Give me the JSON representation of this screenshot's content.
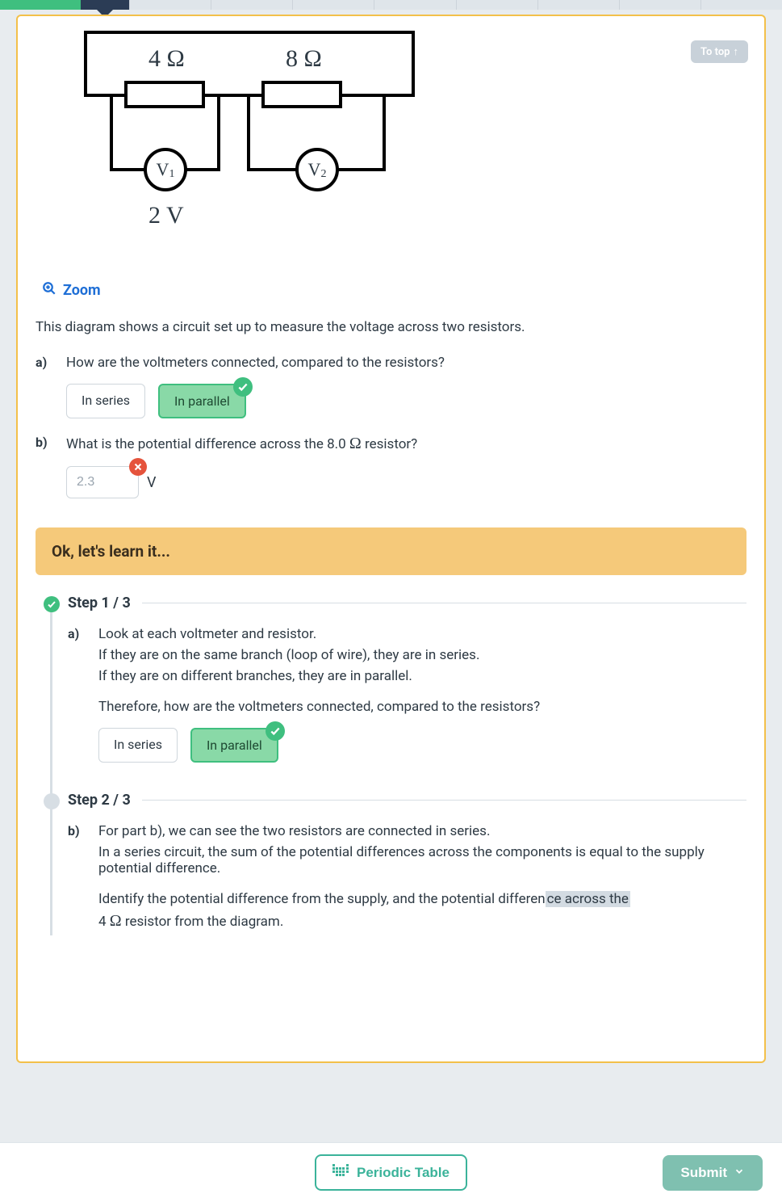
{
  "topbar": {
    "to_top": "To top"
  },
  "diagram": {
    "r1_label": "4 Ω",
    "r2_label": "8 Ω",
    "v1_label": "V",
    "v1_sub": "1",
    "v2_label": "V",
    "v2_sub": "2",
    "reading": "2 V"
  },
  "zoom_label": "Zoom",
  "stem": "This diagram shows a circuit set up to measure the voltage across two resistors.",
  "q_a": {
    "label": "a)",
    "text": "How are the voltmeters connected, compared to the resistors?",
    "choices": {
      "series": "In series",
      "parallel": "In parallel"
    }
  },
  "q_b": {
    "label": "b)",
    "text_before": "What is the potential difference across the 8.0 ",
    "ohm": "Ω",
    "text_after": " resistor?",
    "value": "2.3",
    "unit": "V"
  },
  "banner": "Ok, let's learn it...",
  "step1": {
    "title": "Step 1 / 3",
    "label": "a)",
    "l1": "Look at each voltmeter and resistor.",
    "l2": "If they are on the same branch (loop of wire), they are in series.",
    "l3": "If they are on different branches, they are in parallel.",
    "l4": "Therefore, how are the voltmeters connected, compared to the resistors?",
    "choices": {
      "series": "In series",
      "parallel": "In parallel"
    }
  },
  "step2": {
    "title": "Step 2 / 3",
    "label": "b)",
    "l1": "For part b), we can see the two resistors are connected in series.",
    "l2": "In a series circuit, the sum of the potential differences across the components is equal to the supply potential difference.",
    "l3a": "Identify the potential difference from the supply, and the potential differen",
    "l3b": "ce across the",
    "l4a": "4 ",
    "ohm": "Ω",
    "l4b": " resistor from the diagram."
  },
  "bottom": {
    "periodic": "Periodic Table",
    "submit": "Submit"
  }
}
